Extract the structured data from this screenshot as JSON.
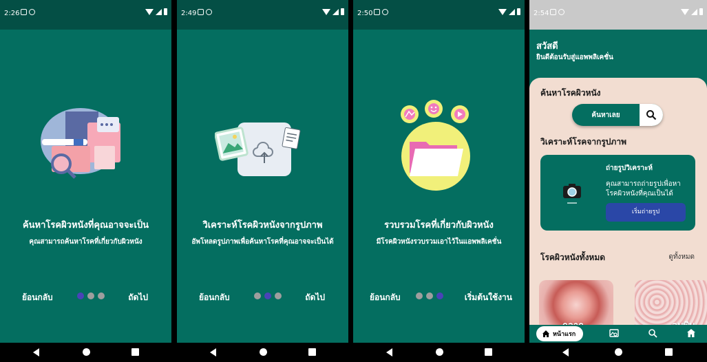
{
  "screens": [
    {
      "time": "2:26",
      "title": "ค้นหาโรคผิวหนังที่คุณอาจจะเป็น",
      "subtitle": "คุณสามารถค้นหาโรคที่เกี่ยวกับผิวหนัง",
      "back_label": "ย้อนกลับ",
      "next_label": "ถัดไป",
      "active_dot": 0
    },
    {
      "time": "2:49",
      "title": "วิเคราะห์โรคผิวหนังจากรูปภาพ",
      "subtitle": "อัพโหลดรูปภาพเพื่อค้นหาโรคที่คุณอาจจะเป็นได้",
      "back_label": "ย้อนกลับ",
      "next_label": "ถัดไป",
      "active_dot": 1
    },
    {
      "time": "2:50",
      "title": "รวบรวมโรคที่เกี่ยวกับผิวหนัง",
      "subtitle": "มีโรคผิวหนังรวบรวมเอาไว้ในแอพพลิเคชั่น",
      "back_label": "ย้อนกลับ",
      "next_label": "เริ่มต้นใช้งาน",
      "active_dot": 2
    }
  ],
  "home": {
    "time": "2:54",
    "greeting": "สวัสดี",
    "greeting_sub": "ยินดีต้อนรับสู่แอพพลิเคชั่น",
    "search_section": "ค้นหาโรคผิวหนัง",
    "search_button": "ค้นหาเลย",
    "analyze_section": "วิเคราะห์โรคจากรูปภาพ",
    "card_title": "ถ่ายรูปวิเคราะห์",
    "card_text": "คุณสามารถถ่ายรูปเพื่อหาโรคผิวหนังที่คุณเป็นได้",
    "card_button": "เริ่มถ่ายรูป",
    "all_section": "โรคผิวหนังทั้งหมด",
    "see_all": "ดูทั้งหมด",
    "diseases": [
      "กลาก",
      "ลมพิษ"
    ],
    "nav_home": "หน้าแรก"
  },
  "colors": {
    "primary": "#046e60",
    "status_bar": "#044f45",
    "dot_active": "#4a43b8",
    "dot_inactive": "#9e9e9e",
    "home_body": "#f2ddd1",
    "card_button": "#2a47a7"
  }
}
